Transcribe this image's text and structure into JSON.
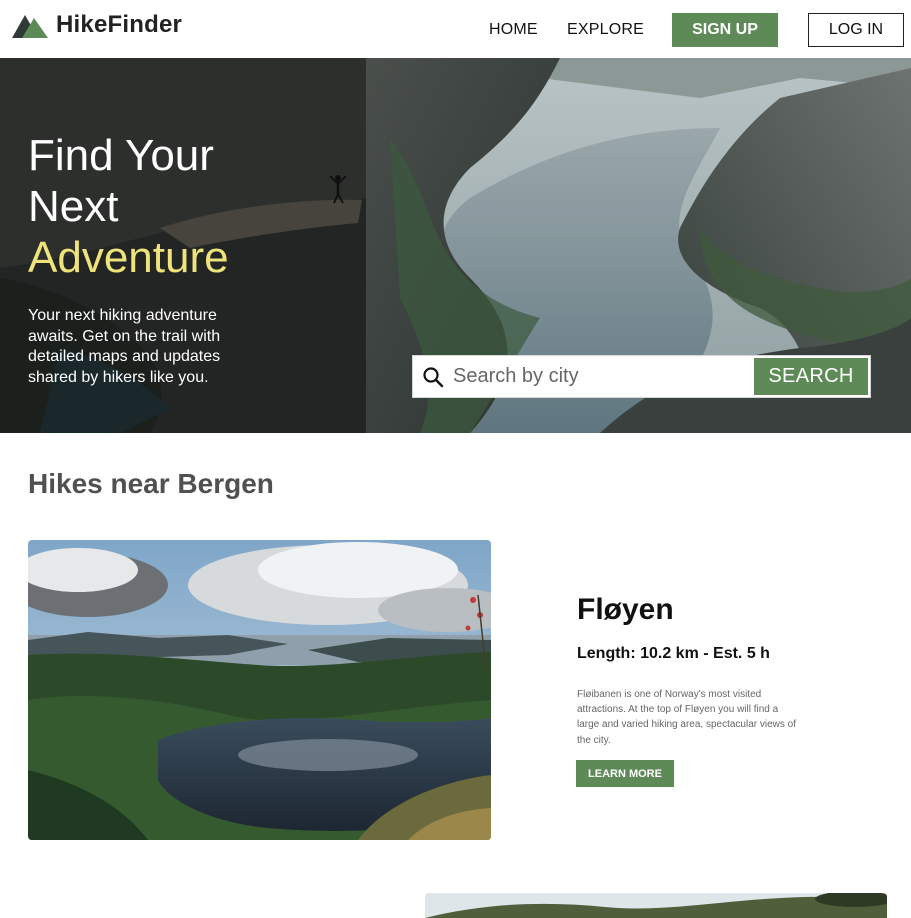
{
  "brand": {
    "name": "HikeFinder",
    "logo_icon": "mountain-icon",
    "accent": "#5e8a58"
  },
  "nav": {
    "home": "HOME",
    "explore": "EXPLORE",
    "signup": "SIGN UP",
    "login": "LOG IN"
  },
  "hero": {
    "title_line1": "Find Your",
    "title_line2": "Next",
    "title_accent": "Adventure",
    "subtitle": "Your next hiking adventure awaits. Get on the trail with detailed maps and updates shared by hikers like you.",
    "accent_color": "#efe37c"
  },
  "search": {
    "placeholder": "Search by city",
    "button": "SEARCH",
    "icon": "search-icon"
  },
  "section": {
    "title": "Hikes near Bergen"
  },
  "hikes": [
    {
      "name": "Fløyen",
      "length": "Length: 10.2 km - Est. 5 h",
      "description": "Fløibanen is one of Norway's most visited attractions. At the top of Fløyen you will find a large and varied hiking area, spectacular views of the city.",
      "button": "LEARN MORE"
    }
  ]
}
